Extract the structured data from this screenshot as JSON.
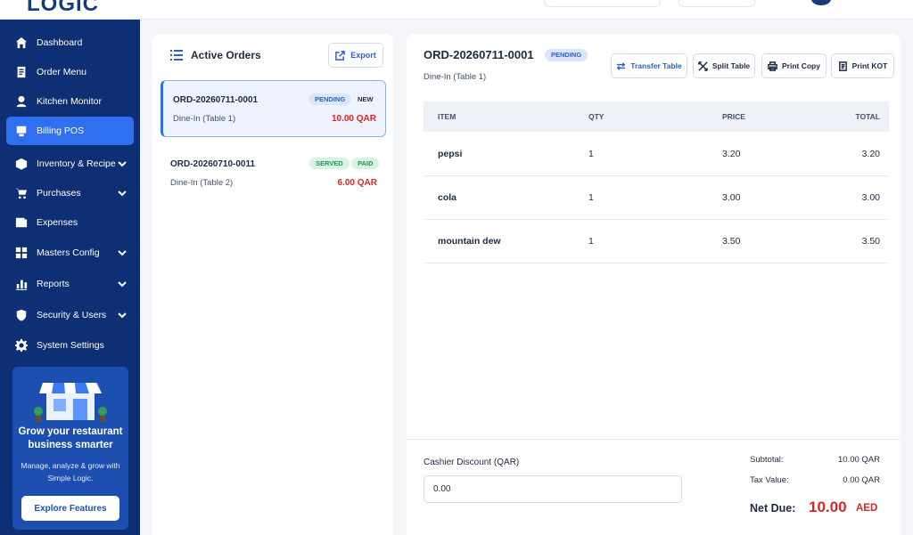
{
  "brand": {
    "logo_text": "LOGIC"
  },
  "sidebar": {
    "items": [
      {
        "label": "Dashboard",
        "icon": "home-icon",
        "active": false,
        "has_chevron": false
      },
      {
        "label": "Order Menu",
        "icon": "order-menu-icon",
        "active": false,
        "has_chevron": false
      },
      {
        "label": "Kitchen Monitor",
        "icon": "chef-icon",
        "active": false,
        "has_chevron": false
      },
      {
        "label": "Billing POS",
        "icon": "billing-icon",
        "active": true,
        "has_chevron": false
      },
      {
        "label": "Inventory & Recipe",
        "icon": "box-icon",
        "active": false,
        "has_chevron": true
      },
      {
        "label": "Purchases",
        "icon": "cart-icon",
        "active": false,
        "has_chevron": true
      },
      {
        "label": "Expenses",
        "icon": "wallet-icon",
        "active": false,
        "has_chevron": false
      },
      {
        "label": "Masters Config",
        "icon": "grid-icon",
        "active": false,
        "has_chevron": true
      },
      {
        "label": "Reports",
        "icon": "bar-chart-icon",
        "active": false,
        "has_chevron": true
      },
      {
        "label": "Security & Users",
        "icon": "shield-icon",
        "active": false,
        "has_chevron": true
      },
      {
        "label": "System Settings",
        "icon": "gear-icon",
        "active": false,
        "has_chevron": false
      }
    ],
    "promo": {
      "title": "Grow your restaurant business smarter",
      "subtitle": "Manage, analyze & grow with Simple Logic.",
      "button": "Explore Features"
    }
  },
  "orders": {
    "title": "Active Orders",
    "export_label": "Export",
    "list": [
      {
        "id": "ORD-20260711-0001",
        "type": "Dine-In (Table 1)",
        "amount": "10.00 QAR",
        "badges": [
          "PENDING",
          "NEW"
        ],
        "selected": true
      },
      {
        "id": "ORD-20260710-0011",
        "type": "Dine-In (Table 2)",
        "amount": "6.00 QAR",
        "badges": [
          "SERVED",
          "PAID"
        ],
        "selected": false
      }
    ]
  },
  "detail": {
    "order_id": "ORD-20260711-0001",
    "status": "PENDING",
    "subtitle": "Dine-In (Table 1)",
    "actions": {
      "transfer_table": "Transfer Table",
      "split_table": "Split Table",
      "print_copy": "Print Copy",
      "print_kot": "Print KOT"
    },
    "table": {
      "headers": {
        "item": "ITEM",
        "qty": "QTY",
        "price": "PRICE",
        "total": "TOTAL"
      },
      "rows": [
        {
          "item": "pepsi",
          "qty": "1",
          "price": "3.20",
          "total": "3.20"
        },
        {
          "item": "cola",
          "qty": "1",
          "price": "3.00",
          "total": "3.00"
        },
        {
          "item": "mountain dew",
          "qty": "1",
          "price": "3.50",
          "total": "3.50"
        }
      ]
    },
    "discount": {
      "label": "Cashier Discount (QAR)",
      "value": "0.00"
    },
    "summary": {
      "subtotal_label": "Subtotal:",
      "subtotal_value": "10.00 QAR",
      "tax_label": "Tax Value:",
      "tax_value": "0.00 QAR",
      "net_label": "Net Due:",
      "net_value": "10.00",
      "net_currency": "AED"
    }
  },
  "colors": {
    "sidebar_bg": "#0e2f73",
    "accent": "#2f6ff0",
    "danger": "#e02424",
    "success": "#22915a"
  }
}
